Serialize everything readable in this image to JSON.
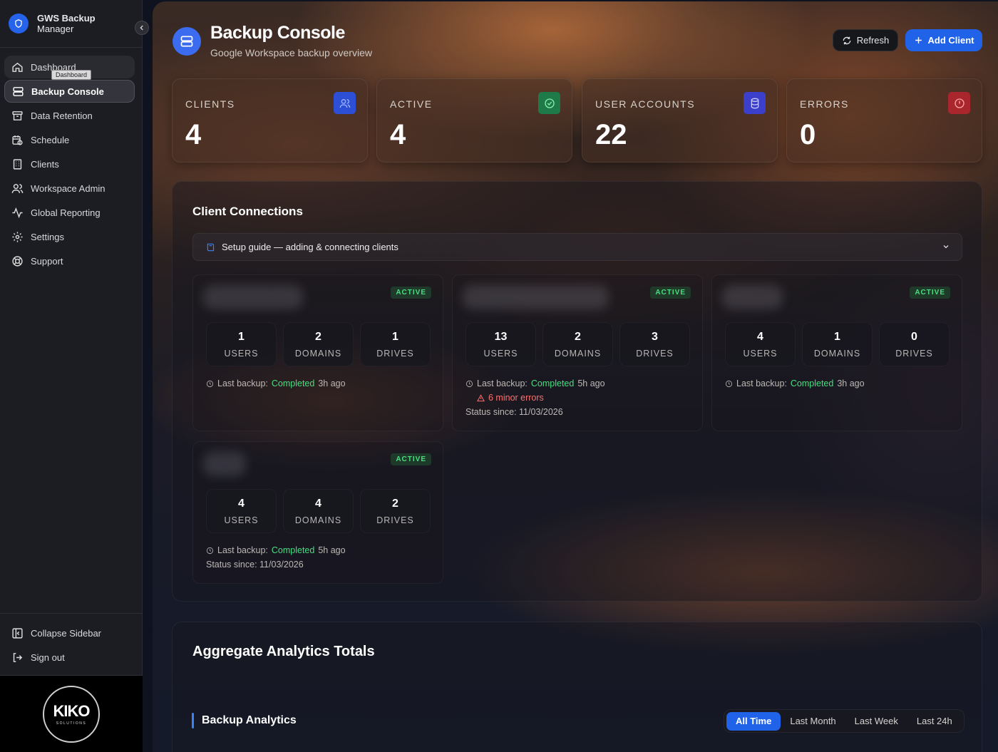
{
  "sidebar": {
    "brand_line1": "GWS Backup",
    "brand_line2": "Manager",
    "tooltip": "Dashboard",
    "items": [
      {
        "label": "Dashboard",
        "icon": "home-icon"
      },
      {
        "label": "Backup Console",
        "icon": "server-icon"
      },
      {
        "label": "Data Retention",
        "icon": "archive-icon"
      },
      {
        "label": "Schedule",
        "icon": "calendar-clock-icon"
      },
      {
        "label": "Clients",
        "icon": "building-icon"
      },
      {
        "label": "Workspace Admin",
        "icon": "users-icon"
      },
      {
        "label": "Global Reporting",
        "icon": "activity-icon"
      },
      {
        "label": "Settings",
        "icon": "gear-icon"
      },
      {
        "label": "Support",
        "icon": "lifebuoy-icon"
      }
    ],
    "bottom": [
      {
        "label": "Collapse Sidebar",
        "icon": "panel-left-icon"
      },
      {
        "label": "Sign out",
        "icon": "sign-out-icon"
      }
    ],
    "logo_main": "KIKO",
    "logo_sub": "SOLUTIONS"
  },
  "header": {
    "title": "Backup Console",
    "subtitle": "Google Workspace backup overview",
    "refresh_label": "Refresh",
    "add_client_label": "Add Client"
  },
  "stats": [
    {
      "label": "CLIENTS",
      "value": "4",
      "icon": "users-icon",
      "color": "#2d4fd6"
    },
    {
      "label": "ACTIVE",
      "value": "4",
      "icon": "check-circle-icon",
      "color": "#1f7a4a"
    },
    {
      "label": "USER ACCOUNTS",
      "value": "22",
      "icon": "database-icon",
      "color": "#3b3fc9"
    },
    {
      "label": "ERRORS",
      "value": "0",
      "icon": "alert-circle-icon",
      "color": "#a8262c"
    }
  ],
  "connections": {
    "title": "Client Connections",
    "guide_label": "Setup guide — adding & connecting clients",
    "clients": [
      {
        "status": "ACTIVE",
        "users": "1",
        "domains": "2",
        "drives": "1",
        "backup_prefix": "Last backup:",
        "backup_status": "Completed",
        "backup_ago": "3h ago",
        "errors": "",
        "since": ""
      },
      {
        "status": "ACTIVE",
        "users": "13",
        "domains": "2",
        "drives": "3",
        "backup_prefix": "Last backup:",
        "backup_status": "Completed",
        "backup_ago": "5h ago",
        "errors": "6 minor errors",
        "since": "Status since: 11/03/2026"
      },
      {
        "status": "ACTIVE",
        "users": "4",
        "domains": "1",
        "drives": "0",
        "backup_prefix": "Last backup:",
        "backup_status": "Completed",
        "backup_ago": "3h ago",
        "errors": "",
        "since": ""
      },
      {
        "status": "ACTIVE",
        "users": "4",
        "domains": "4",
        "drives": "2",
        "backup_prefix": "Last backup:",
        "backup_status": "Completed",
        "backup_ago": "5h ago",
        "errors": "",
        "since": "Status since: 11/03/2026"
      }
    ],
    "metric_labels": {
      "users": "USERS",
      "domains": "DOMAINS",
      "drives": "DRIVES"
    }
  },
  "analytics": {
    "title": "Aggregate Analytics Totals",
    "section_title": "Backup Analytics",
    "ranges": [
      "All Time",
      "Last Month",
      "Last Week",
      "Last 24h"
    ],
    "selected_range": "All Time"
  }
}
